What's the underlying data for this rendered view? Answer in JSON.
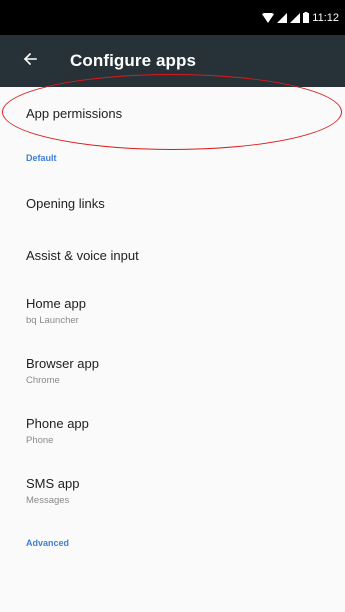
{
  "status_bar": {
    "time": "11:12"
  },
  "app_bar": {
    "title": "Configure apps"
  },
  "list": {
    "app_permissions": "App permissions",
    "default_header": "Default",
    "opening_links": "Opening links",
    "assist_voice": "Assist & voice input",
    "home_app": {
      "label": "Home app",
      "value": "bq Launcher"
    },
    "browser_app": {
      "label": "Browser app",
      "value": "Chrome"
    },
    "phone_app": {
      "label": "Phone app",
      "value": "Phone"
    },
    "sms_app": {
      "label": "SMS app",
      "value": "Messages"
    },
    "advanced_header": "Advanced"
  },
  "colors": {
    "status_bar": "#000000",
    "app_bar": "#263238",
    "accent": "#3f7fd6",
    "annotation": "#d81b1b"
  }
}
